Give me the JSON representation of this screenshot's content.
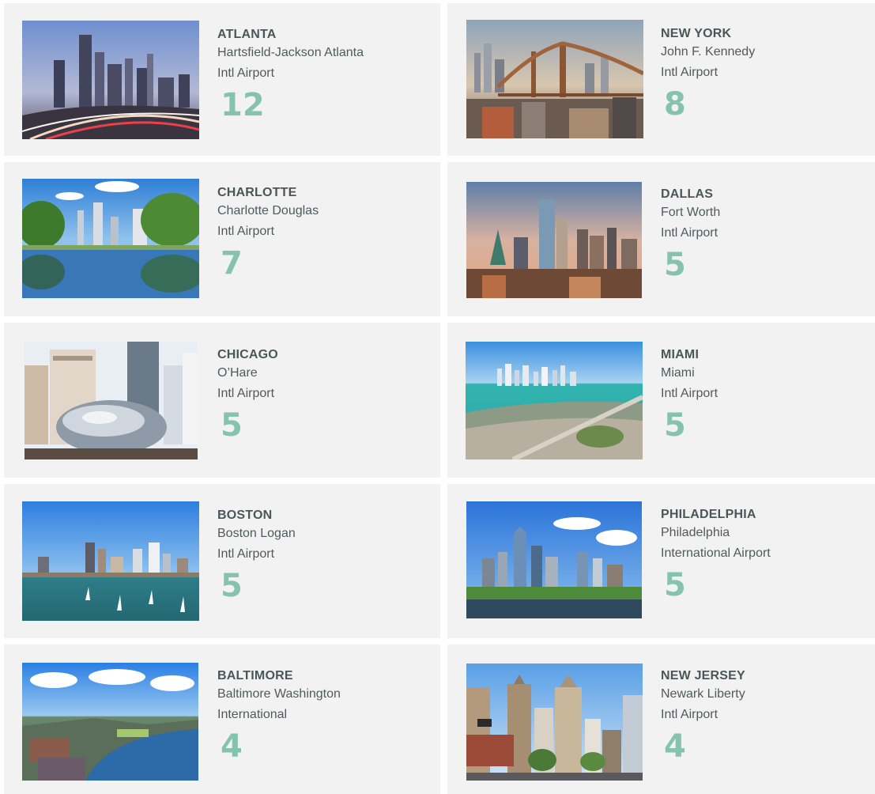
{
  "cards": [
    {
      "city": "ATLANTA",
      "airport_line1": "Hartsfield-Jackson Atlanta",
      "airport_line2": "Intl Airport",
      "count": "12",
      "photo_icon": "atlanta-skyline-photo"
    },
    {
      "city": "NEW YORK",
      "airport_line1": "John F. Kennedy",
      "airport_line2": "Intl Airport",
      "count": "8",
      "photo_icon": "new-york-bridge-photo"
    },
    {
      "city": "CHARLOTTE",
      "airport_line1": "Charlotte Douglas",
      "airport_line2": "Intl Airport",
      "count": "7",
      "photo_icon": "charlotte-park-photo"
    },
    {
      "city": "DALLAS",
      "airport_line1": "Fort Worth",
      "airport_line2": "Intl Airport",
      "count": "5",
      "photo_icon": "dallas-skyline-photo"
    },
    {
      "city": "CHICAGO",
      "airport_line1": "O’Hare",
      "airport_line2": "Intl Airport",
      "count": "5",
      "photo_icon": "chicago-bean-photo"
    },
    {
      "city": "MIAMI",
      "airport_line1": "Miami",
      "airport_line2": "Intl Airport",
      "count": "5",
      "photo_icon": "miami-bay-photo"
    },
    {
      "city": "BOSTON",
      "airport_line1": "Boston Logan",
      "airport_line2": "Intl Airport",
      "count": "5",
      "photo_icon": "boston-harbor-photo"
    },
    {
      "city": "PHILADELPHIA",
      "airport_line1": "Philadelphia",
      "airport_line2": "International Airport",
      "count": "5",
      "photo_icon": "philadelphia-skyline-photo"
    },
    {
      "city": "BALTIMORE",
      "airport_line1": "Baltimore Washington",
      "airport_line2": "International",
      "count": "4",
      "photo_icon": "baltimore-harbor-photo"
    },
    {
      "city": "NEW JERSEY",
      "airport_line1": "Newark Liberty",
      "airport_line2": "Intl Airport",
      "count": "4",
      "photo_icon": "newark-street-photo"
    }
  ],
  "colors": {
    "card_bg": "#f2f2f2",
    "count_accent": "#86c3ae",
    "text": "#4f5a5e"
  }
}
